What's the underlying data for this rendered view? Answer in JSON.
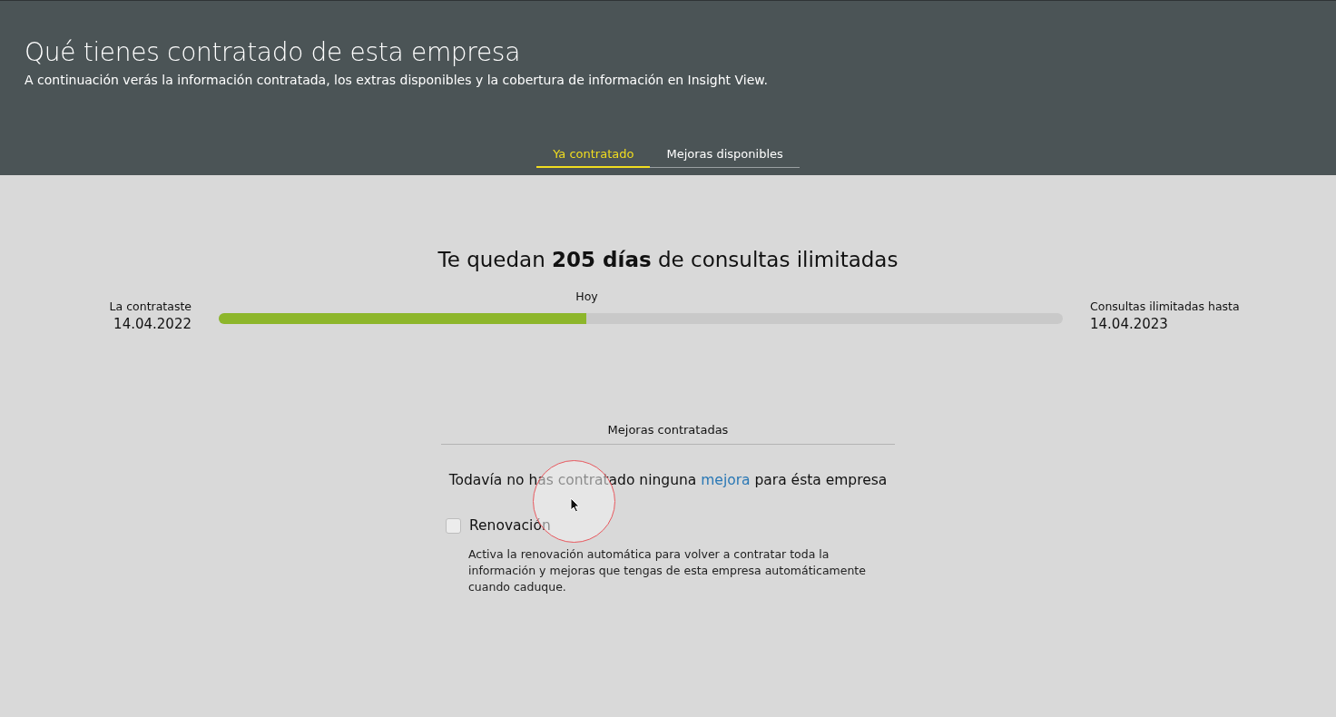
{
  "header": {
    "title": "Qué tienes contratado de esta empresa",
    "subtitle": "A continuación verás la información contratada, los extras disponibles y la cobertura de información en Insight View."
  },
  "tabs": [
    {
      "label": "Ya contratado",
      "selected": true
    },
    {
      "label": "Mejoras disponibles",
      "selected": false
    }
  ],
  "summary": {
    "headline": "Te quedan **205 días** de consultas ilimitadas",
    "start_label": "La contrataste",
    "start_date": "14.04.2022",
    "today_label": "Hoy",
    "level": 0.436,
    "end_label": "Consultas ilimitadas hasta",
    "end_date": "14.04.2023"
  },
  "upgrades": {
    "title": "Mejoras contratadas",
    "empty_before": "Todavía no has contratado ninguna",
    "empty_link": "mejora",
    "empty_after": "para ésta empresa"
  },
  "renewal": {
    "label": "Renovación",
    "checked": false,
    "description": "Activa la renovación automática para volver a contratar toda la información y mejoras que tengas de esta empresa automáticamente cuando caduque."
  }
}
